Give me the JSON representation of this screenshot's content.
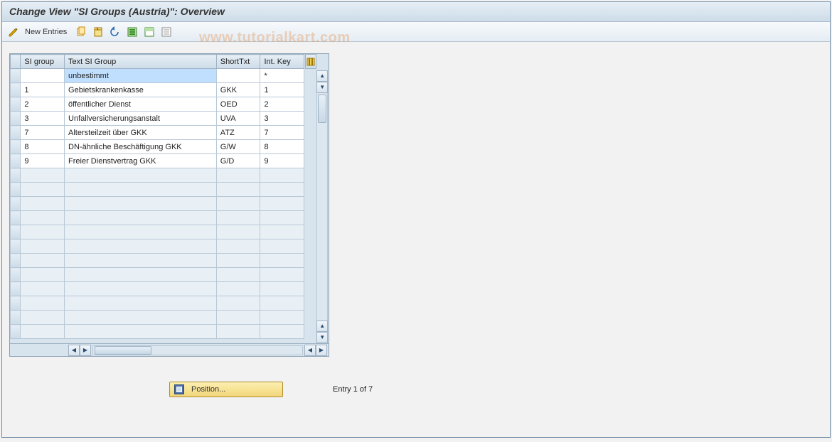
{
  "title": "Change View \"SI Groups (Austria)\": Overview",
  "watermark": "www.tutorialkart.com",
  "toolbar": {
    "new_entries_label": "New Entries"
  },
  "table": {
    "headers": {
      "si_group": "SI group",
      "text_si_group": "Text SI Group",
      "short_txt": "ShortTxt",
      "int_key": "Int. Key"
    },
    "rows": [
      {
        "si": "",
        "text": "unbestimmt",
        "short": "",
        "key": "*"
      },
      {
        "si": "1",
        "text": "Gebietskrankenkasse",
        "short": "GKK",
        "key": "1"
      },
      {
        "si": "2",
        "text": "öffentlicher Dienst",
        "short": "OED",
        "key": "2"
      },
      {
        "si": "3",
        "text": "Unfallversicherungsanstalt",
        "short": "UVA",
        "key": "3"
      },
      {
        "si": "7",
        "text": "Altersteilzeit über GKK",
        "short": "ATZ",
        "key": "7"
      },
      {
        "si": "8",
        "text": "DN-ähnliche Beschäftigung GKK",
        "short": "G/W",
        "key": "8"
      },
      {
        "si": "9",
        "text": "Freier Dienstvertrag GKK",
        "short": "G/D",
        "key": "9"
      }
    ],
    "empty_rows": 12
  },
  "footer": {
    "position_label": "Position...",
    "entry_text": "Entry 1 of 7"
  }
}
